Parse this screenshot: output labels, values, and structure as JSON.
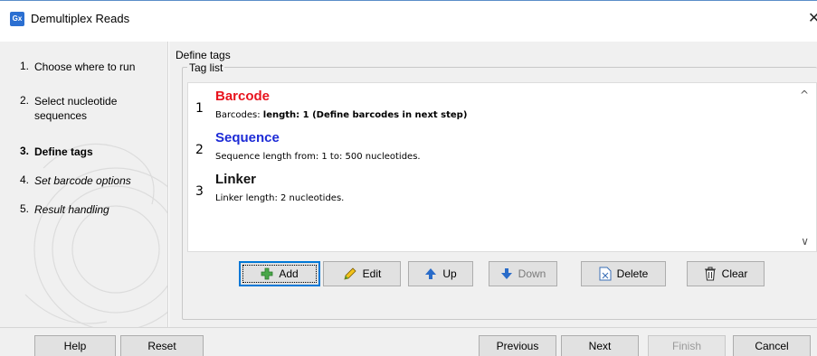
{
  "window": {
    "app_icon_text": "Gx",
    "title": "Demultiplex Reads",
    "close_glyph": "✕"
  },
  "steps": [
    {
      "num": "1.",
      "label": "Choose where to run",
      "state": "normal"
    },
    {
      "num": "2.",
      "label": "Select nucleotide sequences",
      "state": "normal"
    },
    {
      "num": "3.",
      "label": "Define tags",
      "state": "active"
    },
    {
      "num": "4.",
      "label": "Set barcode options",
      "state": "italic"
    },
    {
      "num": "5.",
      "label": "Result handling",
      "state": "italic"
    }
  ],
  "main": {
    "section_title": "Define tags",
    "group_label": "Tag list",
    "tags": [
      {
        "index": "1",
        "name": "Barcode",
        "color": "#e8141e",
        "desc_prefix": "Barcodes: ",
        "desc_bold": "length: 1 (Define barcodes in next step)"
      },
      {
        "index": "2",
        "name": "Sequence",
        "color": "#1d2bd6",
        "desc_prefix": "Sequence length from: 1 to: 500 nucleotides.",
        "desc_bold": ""
      },
      {
        "index": "3",
        "name": "Linker",
        "color": "#111111",
        "desc_prefix": "Linker length: 2 nucleotides.",
        "desc_bold": ""
      }
    ],
    "scroll_up_glyph": "^",
    "scroll_down_glyph": "∨",
    "buttons": {
      "add": "Add",
      "edit": "Edit",
      "up": "Up",
      "down": "Down",
      "delete": "Delete",
      "clear": "Clear"
    },
    "button_icons": {
      "add": "plus-icon",
      "edit": "pencil-icon",
      "up": "arrow-up-icon",
      "down": "arrow-down-icon",
      "delete": "delete-icon",
      "clear": "trash-icon"
    }
  },
  "footer": {
    "help": "Help",
    "reset": "Reset",
    "previous": "Previous",
    "next": "Next",
    "finish": "Finish",
    "cancel": "Cancel"
  },
  "colors": {
    "accent": "#0078d7",
    "barcode": "#e8141e",
    "sequence": "#1d2bd6",
    "arrow_blue": "#2a6cc9"
  }
}
